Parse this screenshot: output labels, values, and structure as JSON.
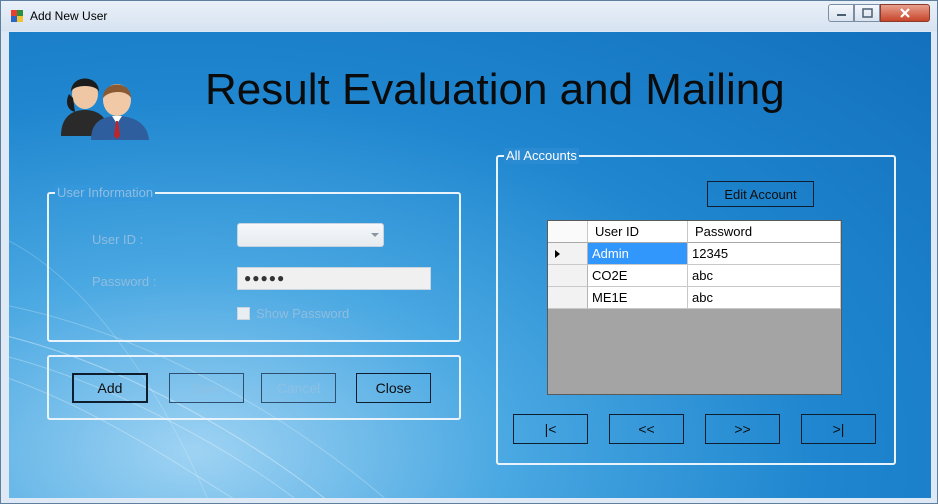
{
  "window": {
    "title": "Add New User"
  },
  "header": {
    "title": "Result Evaluation and Mailing"
  },
  "user_info": {
    "legend": "User Information",
    "user_id_label": "User ID :",
    "password_label": "Password :",
    "password_value": "●●●●●",
    "show_password_label": "Show Password"
  },
  "actions": {
    "add": "Add",
    "save": "Save",
    "cancel": "Cancel",
    "close": "Close"
  },
  "accounts": {
    "legend": "All Accounts",
    "edit_button": "Edit Account",
    "columns": [
      "User ID",
      "Password"
    ],
    "rows": [
      {
        "user_id": "Admin",
        "password": "12345"
      },
      {
        "user_id": "CO2E",
        "password": "abc"
      },
      {
        "user_id": "ME1E",
        "password": "abc"
      }
    ],
    "nav": {
      "first": "|<",
      "prev": "<<",
      "next": ">>",
      "last": ">|"
    }
  },
  "colors": {
    "client_bg": "#1f86cf",
    "grid_empty": "#a4a4a4",
    "selection": "#3297fd"
  }
}
